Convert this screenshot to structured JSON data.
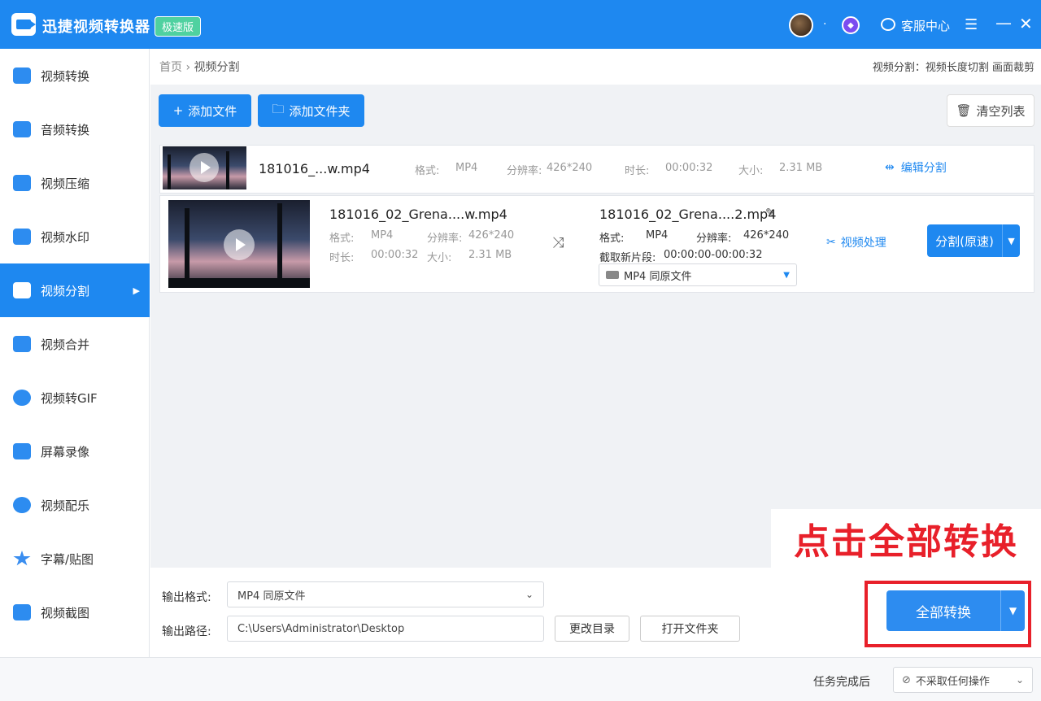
{
  "titlebar": {
    "app_title": "迅捷视频转换器",
    "edition_badge": "极速版",
    "service_label": "客服中心"
  },
  "sidebar": {
    "items": [
      {
        "label": "视频转换"
      },
      {
        "label": "音频转换"
      },
      {
        "label": "视频压缩"
      },
      {
        "label": "视频水印"
      },
      {
        "label": "视频分割"
      },
      {
        "label": "视频合并"
      },
      {
        "label": "视频转GIF"
      },
      {
        "label": "屏幕录像"
      },
      {
        "label": "视频配乐"
      },
      {
        "label": "字幕/贴图"
      },
      {
        "label": "视频截图"
      }
    ],
    "active_index": 4
  },
  "breadcrumb": {
    "home": "首页",
    "separator": "›",
    "current": "视频分割"
  },
  "split_modes": "视频分割：视频长度切割 画面裁剪",
  "toolbar": {
    "add_file": "添加文件",
    "add_folder": "添加文件夹",
    "clear_list": "清空列表"
  },
  "row1": {
    "filename": "181016_...w.mp4",
    "format_label": "格式:",
    "format_value": "MP4",
    "resolution_label": "分辨率:",
    "resolution_value": "426*240",
    "duration_label": "时长:",
    "duration_value": "00:00:32",
    "size_label": "大小:",
    "size_value": "2.31 MB",
    "edit_split": "编辑分割"
  },
  "row2": {
    "src_filename": "181016_02_Grena....w.mp4",
    "src_format_label": "格式:",
    "src_format_value": "MP4",
    "src_resolution_label": "分辨率:",
    "src_resolution_value": "426*240",
    "src_duration_label": "时长:",
    "src_duration_value": "00:00:32",
    "src_size_label": "大小:",
    "src_size_value": "2.31 MB",
    "out_filename": "181016_02_Grena....2.mp4",
    "out_format_label": "格式:",
    "out_format_value": "MP4",
    "out_resolution_label": "分辨率:",
    "out_resolution_value": "426*240",
    "clip_label": "截取新片段:",
    "clip_value": "00:00:00-00:00:32",
    "out_select": "MP4  同原文件",
    "video_processing": "视频处理",
    "split_button": "分割(原速)"
  },
  "annotation": "点击全部转换",
  "bottom": {
    "output_format_label": "输出格式:",
    "output_format_value": "MP4  同原文件",
    "output_path_label": "输出路径:",
    "output_path_value": "C:\\Users\\Administrator\\Desktop",
    "change_dir": "更改目录",
    "open_folder": "打开文件夹",
    "convert_all": "全部转换"
  },
  "footer": {
    "after_task_label": "任务完成后",
    "after_task_value": "不采取任何操作"
  },
  "colors": {
    "brand_blue": "#1e88f0",
    "annotation_red": "#e8202a",
    "edition_green": "#4fd1a0"
  }
}
